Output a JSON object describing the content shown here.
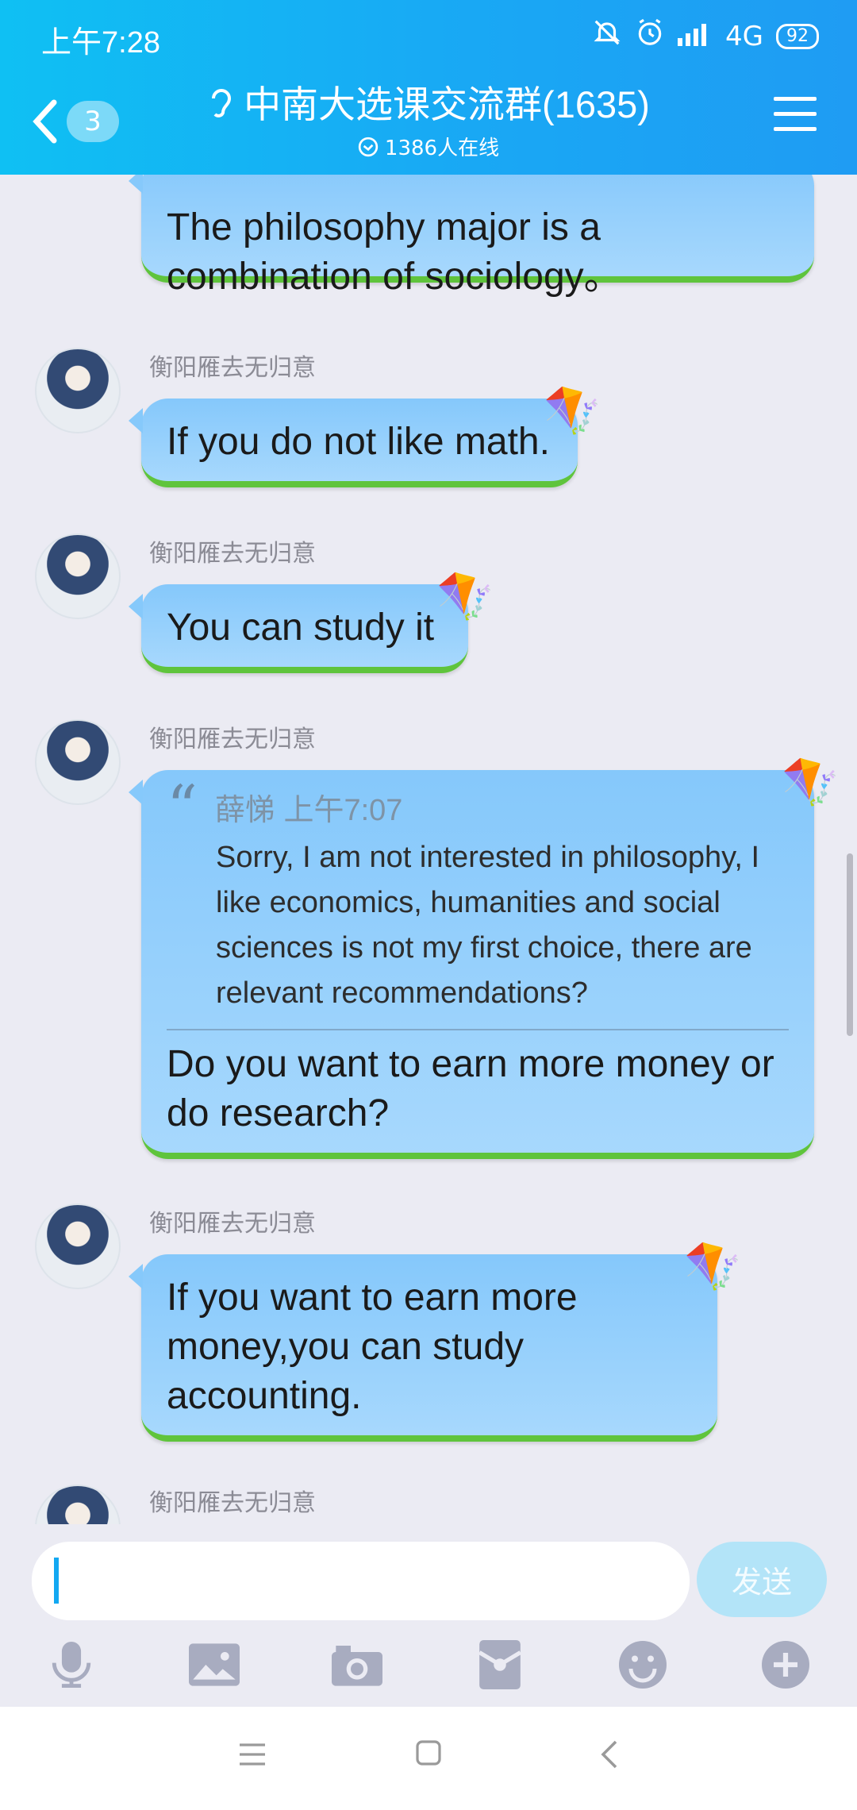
{
  "status_bar": {
    "time": "上午7:28",
    "network": "4G",
    "battery": "92"
  },
  "header": {
    "unread_count": "3",
    "title": "中南大选课交流群(1635)",
    "online": "1386人在线"
  },
  "messages": [
    {
      "type": "text",
      "sender": "",
      "text": "The philosophy major is a combination of sociology。"
    },
    {
      "type": "text",
      "sender": "衡阳雁去无归意",
      "text": "If you do not like math."
    },
    {
      "type": "text",
      "sender": "衡阳雁去无归意",
      "text": "You can study it"
    },
    {
      "type": "reply",
      "sender": "衡阳雁去无归意",
      "quote_author": "薛悌",
      "quote_time": "上午7:07",
      "quote_text": "Sorry, I am not interested in philosophy, I like economics, humanities and social sciences is not my first choice, there are relevant recommendations?",
      "text": "Do you want to earn more money or do research?"
    },
    {
      "type": "text",
      "sender": "衡阳雁去无归意",
      "text": "If you want to earn more money,you can study accounting."
    },
    {
      "type": "text",
      "sender": "衡阳雁去无归意",
      "text": ""
    }
  ],
  "composer": {
    "send_label": "发送",
    "placeholder": ""
  },
  "toolbar": [
    "microphone-icon",
    "image-icon",
    "camera-icon",
    "red-packet-icon",
    "emoji-icon",
    "plus-icon"
  ],
  "colors": {
    "header_start": "#0fc0f3",
    "header_end": "#1f9cf3",
    "bubble": "#95d0fc",
    "bubble_border": "#5fc43c",
    "send_disabled": "#b3e4f8"
  }
}
